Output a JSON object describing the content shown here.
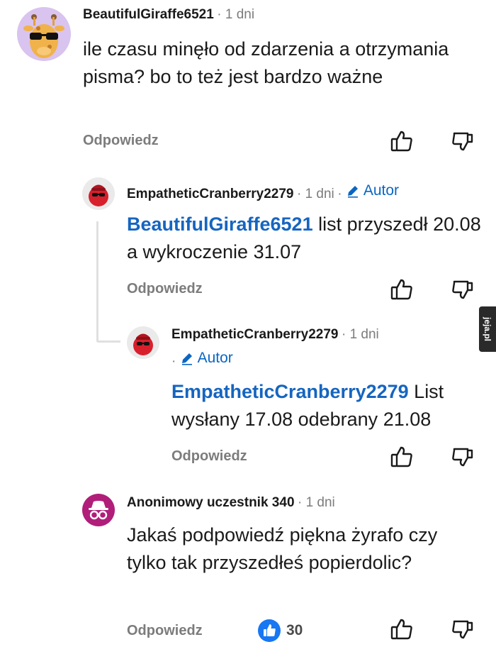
{
  "comments": [
    {
      "username": "BeautifulGiraffe6521",
      "time": "1 dni",
      "body": "ile czasu minęło od zdarzenia a otrzymania pisma? bo to też jest bardzo ważne",
      "reply_label": "Odpowiedz",
      "avatar_icon": "giraffe-sunglasses-avatar"
    },
    {
      "username": "EmpatheticCranberry2279",
      "time": "1 dni",
      "author_label": "Autor",
      "mention": "BeautifulGiraffe6521",
      "body": "list przyszedł 20.08 a wykroczenie 31.07",
      "reply_label": "Odpowiedz",
      "avatar_icon": "cranberry-avatar"
    },
    {
      "username": "EmpatheticCranberry2279",
      "time": "1 dni",
      "author_label": "Autor",
      "mention": "EmpatheticCranberry2279",
      "body": "List wysłany 17.08 odebrany 21.08",
      "reply_label": "Odpowiedz",
      "avatar_icon": "cranberry-avatar"
    },
    {
      "username": "Anonimowy uczestnik 340",
      "time": "1 dni",
      "body": "Jakaś podpowiedź piękna żyrafo czy tylko tak przyszedłeś popierdolic?",
      "reply_label": "Odpowiedz",
      "likes": "30",
      "avatar_icon": "incognito-avatar"
    }
  ],
  "watermark": "jeja.pl",
  "colors": {
    "text": "#1a1a1b",
    "muted": "#7c7c7c",
    "link": "#1565c0",
    "author": "#0a66c2",
    "giraffe_bg": "#d9c3ef",
    "incognito_bg": "#b01e7a",
    "like_blue": "#1877f2"
  }
}
